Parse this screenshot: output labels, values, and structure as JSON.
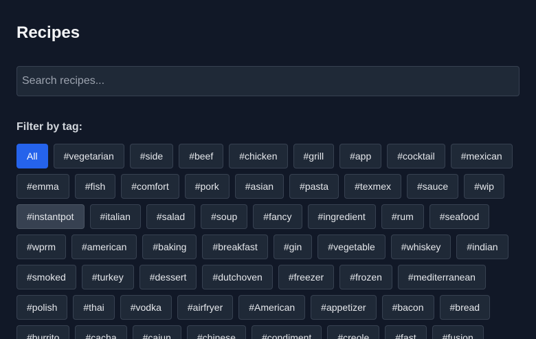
{
  "page": {
    "title": "Recipes"
  },
  "search": {
    "placeholder": "Search recipes..."
  },
  "filter": {
    "label": "Filter by tag:",
    "selected": "All",
    "hovered": "#instantpot",
    "tags": [
      "All",
      "#vegetarian",
      "#side",
      "#beef",
      "#chicken",
      "#grill",
      "#app",
      "#cocktail",
      "#mexican",
      "#emma",
      "#fish",
      "#comfort",
      "#pork",
      "#asian",
      "#pasta",
      "#texmex",
      "#sauce",
      "#wip",
      "#instantpot",
      "#italian",
      "#salad",
      "#soup",
      "#fancy",
      "#ingredient",
      "#rum",
      "#seafood",
      "#wprm",
      "#american",
      "#baking",
      "#breakfast",
      "#gin",
      "#vegetable",
      "#whiskey",
      "#indian",
      "#smoked",
      "#turkey",
      "#dessert",
      "#dutchoven",
      "#freezer",
      "#frozen",
      "#mediterranean",
      "#polish",
      "#thai",
      "#vodka",
      "#airfryer",
      "#American",
      "#appetizer",
      "#bacon",
      "#bread",
      "#burrito",
      "#cacha",
      "#cajun",
      "#chinese",
      "#condiment",
      "#creole",
      "#fast",
      "#fusion"
    ]
  },
  "colors": {
    "background": "#111827",
    "surface": "#1f2937",
    "border": "#374151",
    "accent": "#2563eb"
  }
}
